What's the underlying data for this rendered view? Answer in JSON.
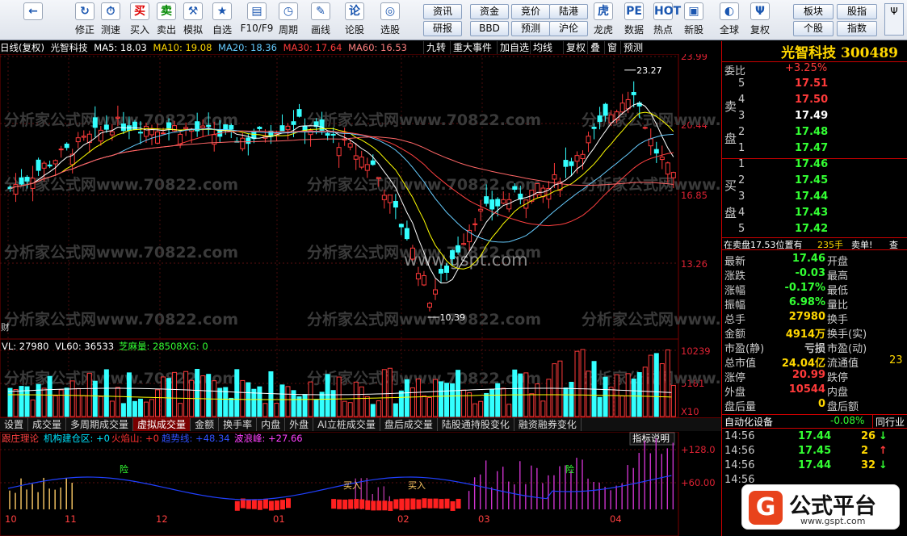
{
  "toolbar": {
    "buttons": [
      {
        "label": "",
        "icon": "←"
      },
      {
        "label": "修正",
        "icon": "↻"
      },
      {
        "label": "测速",
        "icon": "⏱"
      },
      {
        "label": "买入",
        "icon": "买"
      },
      {
        "label": "卖出",
        "icon": "卖"
      },
      {
        "label": "模拟",
        "icon": "⚒"
      },
      {
        "label": "自选",
        "icon": "★"
      },
      {
        "label": "F10/F9",
        "icon": "▤"
      },
      {
        "label": "周期",
        "icon": "◷"
      },
      {
        "label": "画线",
        "icon": "✎"
      },
      {
        "label": "论股",
        "icon": "论"
      },
      {
        "label": "选股",
        "icon": "◎"
      },
      {
        "label": "龙虎",
        "icon": "虎"
      },
      {
        "label": "数据",
        "icon": "PE"
      },
      {
        "label": "热点",
        "icon": "HOT"
      },
      {
        "label": "新股",
        "icon": "▣"
      },
      {
        "label": "全球",
        "icon": "◐"
      },
      {
        "label": "复权",
        "icon": "Ψ"
      }
    ],
    "quick": [
      "资讯",
      "资金",
      "竞价",
      "陆港",
      "研报",
      "BBD",
      "预测",
      "沪伦",
      "板块",
      "股指",
      "个股",
      "指数"
    ]
  },
  "chart": {
    "header": {
      "mode": "日线(复权)",
      "name": "光智科技",
      "ma5": "MA5: 18.03",
      "ma10": "MA10: 19.08",
      "ma20": "MA20: 18.36",
      "ma30": "MA30: 17.64",
      "ma60": "MA60: 16.53"
    },
    "right_buttons": [
      "九转",
      "重大事件",
      "加自选",
      "均线",
      "复权",
      "叠",
      "窗",
      "预测"
    ],
    "price_axis": [
      "23.99",
      "20.44",
      "16.85",
      "13.26"
    ],
    "high_label": "23.27",
    "low_label": "10.39",
    "volume_header": {
      "vl": "VL: 27980",
      "vl60": "VL60: 36533",
      "zm": "芝麻量: 28508",
      "xg": "XG: 0"
    },
    "volume_axis": [
      "10239",
      "5181",
      "X10"
    ],
    "tabs": [
      "设置",
      "成交量",
      "多周期成交量",
      "虚拟成交量",
      "金额",
      "换手率",
      "内盘",
      "外盘",
      "AI立桩成交量",
      "盘后成交量",
      "陆股通持股变化",
      "融资融券变化"
    ],
    "active_tab": "虚拟成交量",
    "indicator_header": {
      "name": "跟庄理论",
      "jg": "机构建仓区: +0",
      "hy": "火焰山: +0",
      "qs": "趋势线: +48.34",
      "blf": "波浪峰: +27.66",
      "help": "指标说明"
    },
    "indicator_axis": [
      "+128.0",
      "+60.00"
    ],
    "markers": {
      "danger": "险",
      "buy": "买入"
    },
    "months": [
      "10",
      "11",
      "12",
      "01",
      "02",
      "03",
      "04"
    ],
    "watermarks": [
      "分析家公式网www.70822.com",
      "www.gspt.com"
    ]
  },
  "quote": {
    "name": "光智科技",
    "code": "300489",
    "weibi_label": "委比",
    "weibi": "+3.25%",
    "sell_label": "卖",
    "sell_label2": "盘",
    "buy_label": "买",
    "buy_label2": "盘",
    "asks": [
      {
        "lv": "5",
        "p": "17.51"
      },
      {
        "lv": "4",
        "p": "17.50"
      },
      {
        "lv": "3",
        "p": "17.49"
      },
      {
        "lv": "2",
        "p": "17.48"
      },
      {
        "lv": "1",
        "p": "17.47"
      }
    ],
    "bids": [
      {
        "lv": "1",
        "p": "17.46"
      },
      {
        "lv": "2",
        "p": "17.45"
      },
      {
        "lv": "3",
        "p": "17.44"
      },
      {
        "lv": "4",
        "p": "17.43"
      },
      {
        "lv": "5",
        "p": "17.42"
      }
    ],
    "status": {
      "text": "在卖盘17.53位置有",
      "vol": "235手",
      "tag": "卖单!",
      "more": "查"
    },
    "stats": [
      {
        "l": "最新",
        "v": "17.46",
        "c": "grn",
        "l2": "开盘",
        "v2": ""
      },
      {
        "l": "涨跌",
        "v": "-0.03",
        "c": "grn",
        "l2": "最高",
        "v2": ""
      },
      {
        "l": "涨幅",
        "v": "-0.17%",
        "c": "grn",
        "l2": "最低",
        "v2": ""
      },
      {
        "l": "振幅",
        "v": "6.98%",
        "c": "grn",
        "l2": "量比",
        "v2": ""
      },
      {
        "l": "总手",
        "v": "27980",
        "c": "yel",
        "l2": "换手",
        "v2": ""
      },
      {
        "l": "金额",
        "v": "4914万",
        "c": "yel",
        "l2": "换手(实)",
        "v2": ""
      },
      {
        "l": "市盈(静)",
        "v": "亏损",
        "c": "lbl",
        "l2": "市盈(动)",
        "v2": ""
      },
      {
        "l": "总市值",
        "v": "24.04亿",
        "c": "yel",
        "l2": "流通值",
        "v2": "23"
      },
      {
        "l": "涨停",
        "v": "20.99",
        "c": "red",
        "l2": "跌停",
        "v2": ""
      },
      {
        "l": "外盘",
        "v": "10544",
        "c": "red",
        "l2": "内盘",
        "v2": ""
      },
      {
        "l": "盘后量",
        "v": "0",
        "c": "yel",
        "l2": "盘后额",
        "v2": ""
      }
    ],
    "industry": {
      "name": "自动化设备",
      "chg": "-0.08%",
      "tag": "同行业"
    },
    "ticks": [
      {
        "t": "14:56",
        "p": "17.44",
        "v": "26",
        "d": "↓"
      },
      {
        "t": "14:56",
        "p": "17.45",
        "v": "2",
        "d": "↑"
      },
      {
        "t": "14:56",
        "p": "17.44",
        "v": "32",
        "d": "↓"
      },
      {
        "t": "14:56",
        "p": "",
        "v": "",
        "d": ""
      }
    ]
  },
  "logo": {
    "text": "公式平台",
    "url": "www.gspt.com"
  },
  "colors": {
    "up": "#ff3a3a",
    "down": "#33ffff",
    "ma5": "#ffffff",
    "ma10": "#ffff00",
    "ma20": "#66ccff",
    "ma30": "#ff4040",
    "ma60": "#ff6666"
  }
}
